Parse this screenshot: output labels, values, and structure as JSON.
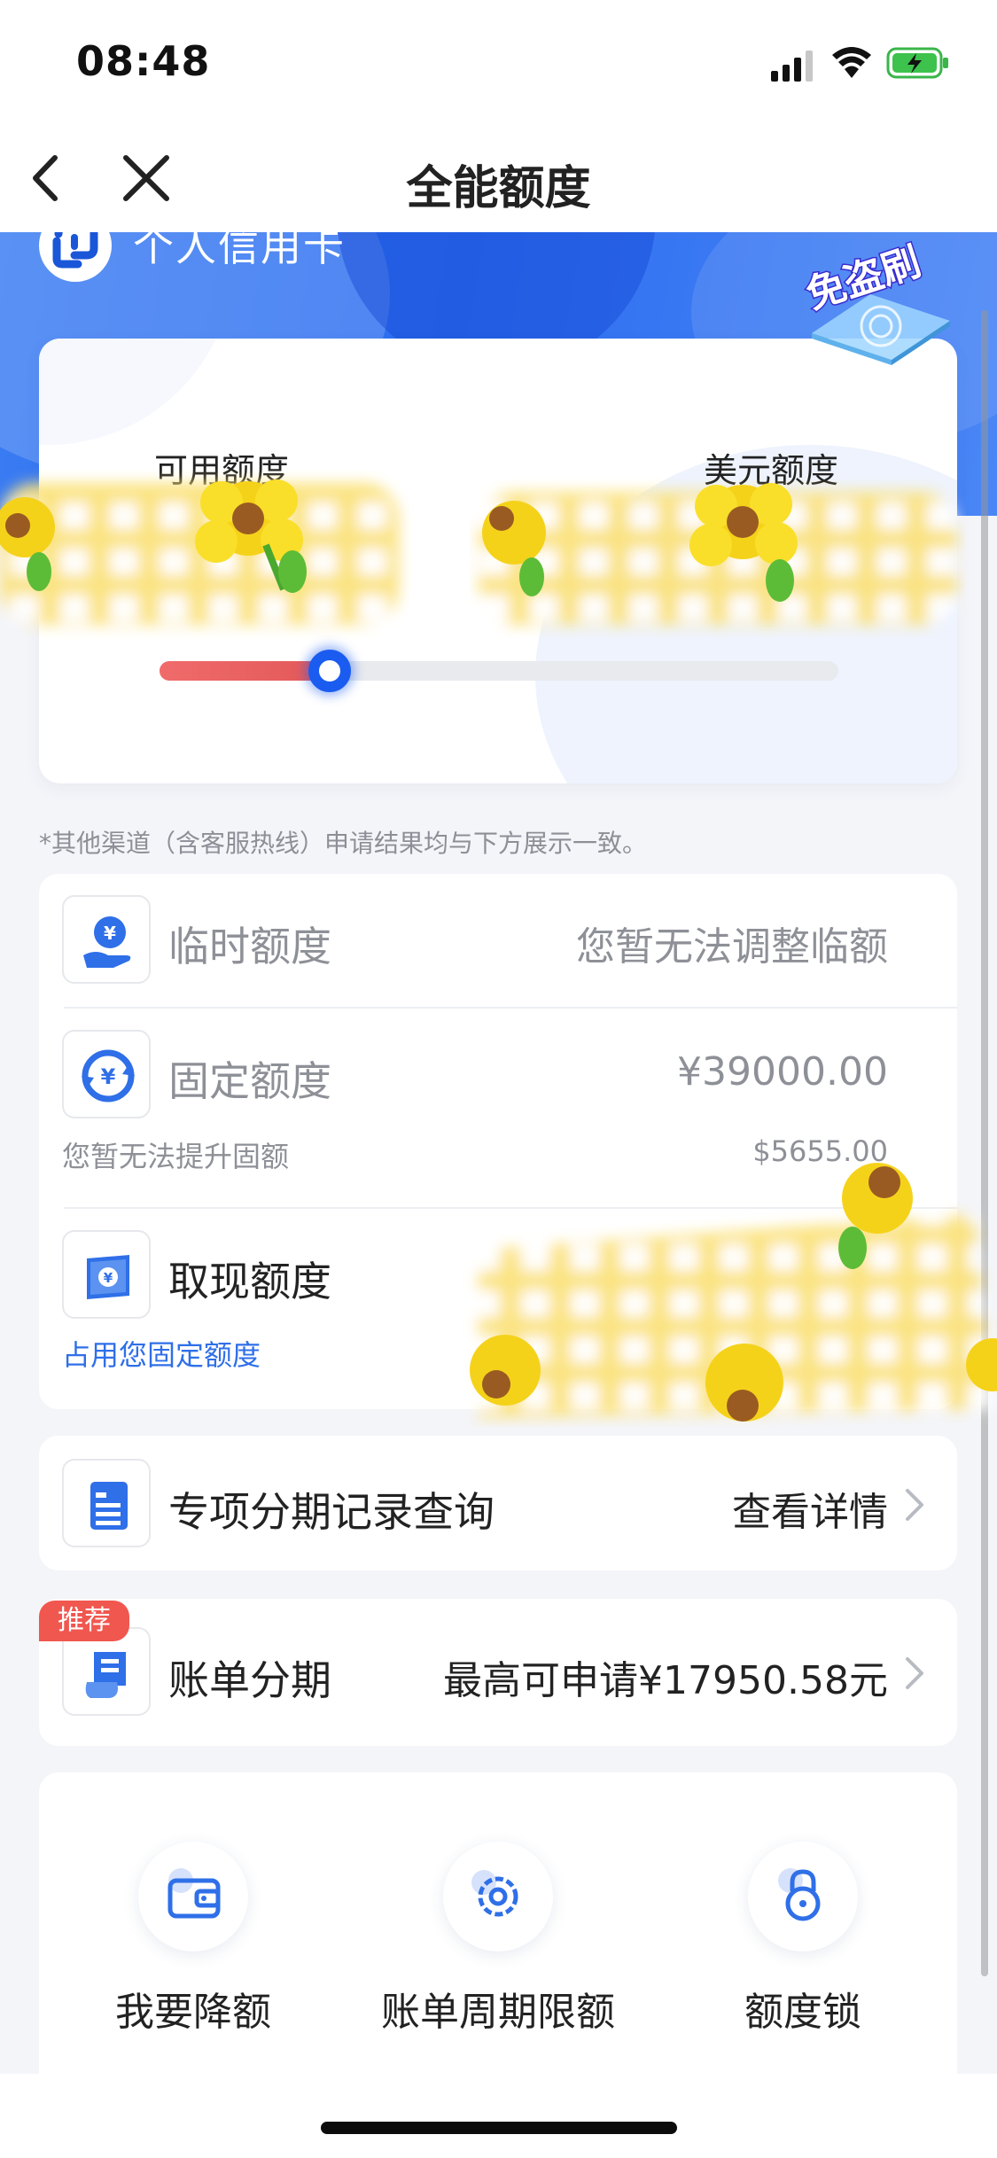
{
  "status_bar": {
    "time": "08:48",
    "signal_icon": "cellular-signal-icon",
    "wifi_icon": "wifi-icon",
    "battery_icon": "battery-charging-icon"
  },
  "nav": {
    "title": "全能额度",
    "back_icon": "chevron-left-icon",
    "close_icon": "close-icon"
  },
  "header": {
    "brand_name": "个人信用卡",
    "badge_text": "免盗刷",
    "brand_color": "#2d6ef0"
  },
  "limit_card": {
    "available_label": "可用额度",
    "usd_label": "美元额度",
    "slider_fill_percent": 25
  },
  "note": "*其他渠道（含客服热线）申请结果均与下方展示一致。",
  "quota_list": {
    "temporary": {
      "icon": "hand-yuan-icon",
      "title": "临时额度",
      "value": "您暂无法调整临额"
    },
    "fixed": {
      "icon": "yuan-cycle-icon",
      "title": "固定额度",
      "value": "¥39000.00",
      "sub_left": "您暂无法提升固额",
      "sub_right": "$5655.00"
    },
    "cash": {
      "icon": "cash-note-icon",
      "title": "取现额度",
      "sub_link": "占用您固定额度"
    }
  },
  "installment_record": {
    "icon": "document-list-icon",
    "title": "专项分期记录查询",
    "action": "查看详情"
  },
  "bill_installment": {
    "tag": "推荐",
    "icon": "bill-scroll-icon",
    "title": "账单分期",
    "value": "最高可申请¥17950.58元"
  },
  "actions": [
    {
      "icon": "wallet-icon",
      "label": "我要降额"
    },
    {
      "icon": "gear-icon",
      "label": "账单周期限额"
    },
    {
      "icon": "lock-icon",
      "label": "额度锁"
    }
  ],
  "colors": {
    "accent": "#1b5cf0",
    "danger": "#f0574f",
    "muted": "#8e9097",
    "link": "#2f6fe8"
  }
}
